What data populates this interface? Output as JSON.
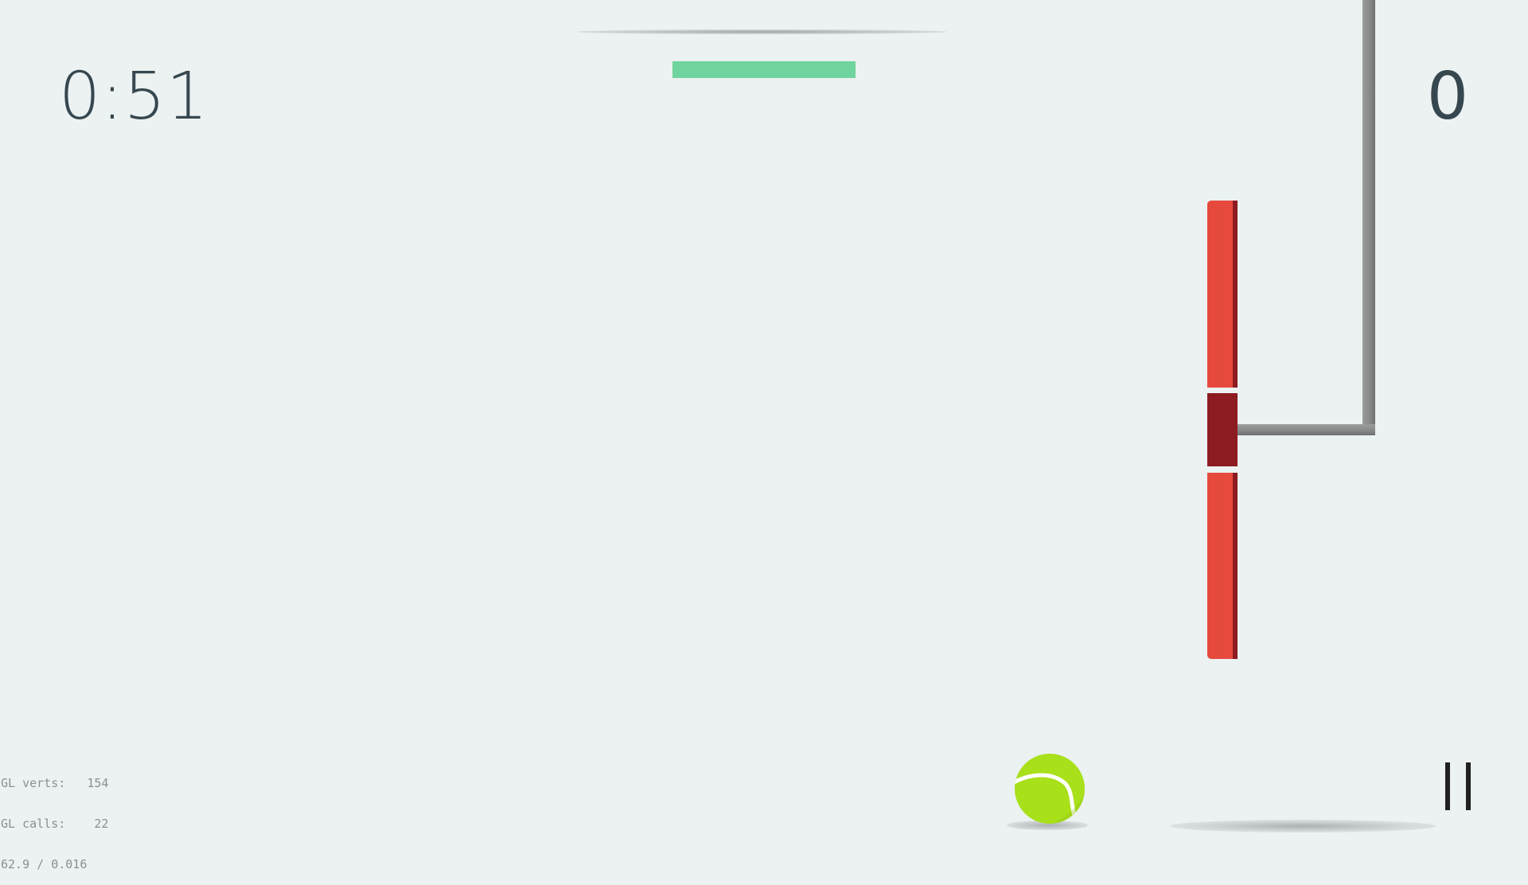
{
  "hud": {
    "timer": "0:51",
    "score": "0"
  },
  "debug": {
    "lines": [
      "GL verts:   154",
      "GL calls:    22",
      "62.9 / 0.016"
    ]
  },
  "colors": {
    "background": "#ecf1f2",
    "text": "#37474f",
    "opponent_paddle": "#6fd49d",
    "player_paddle": "#e64a3d",
    "player_paddle_center": "#8d1b22",
    "ball": "#a8e01a",
    "pipe": "#8c8e8e"
  },
  "icons": {
    "ball": "tennis-ball-icon",
    "pause": "pause-icon"
  }
}
